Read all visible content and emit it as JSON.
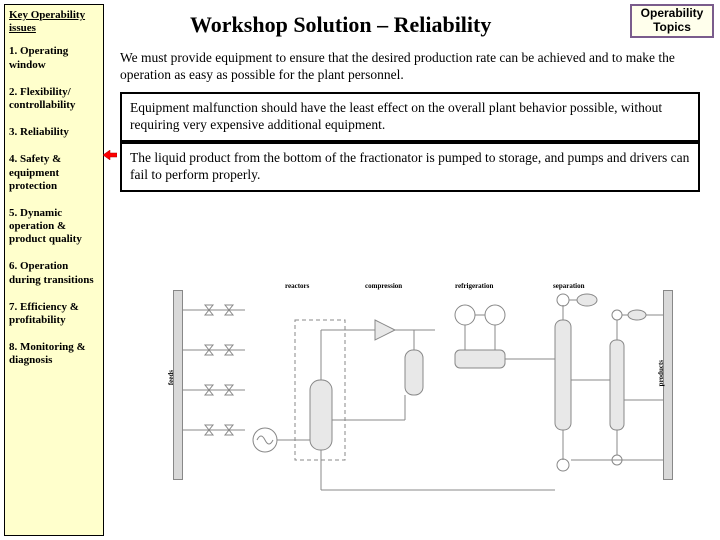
{
  "sidebar": {
    "title": "Key Operability issues",
    "items": [
      "1. Operating window",
      "2. Flexibility/ controllability",
      "3. Reliability",
      "4. Safety & equipment protection",
      "5. Dynamic operation & product quality",
      "6. Operation during transitions",
      "7. Efficiency & profitability",
      "8. Monitoring & diagnosis"
    ]
  },
  "topics_button": "Operability Topics",
  "title": "Workshop Solution – Reliability",
  "intro": "We must provide equipment to ensure that the desired production rate can be achieved and to make the operation as easy as possible for the plant personnel.",
  "box1": "Equipment malfunction should have the least effect on the overall plant behavior possible, without requiring very expensive additional equipment.",
  "box2": "The liquid product from the bottom of the fractionator is pumped to storage, and pumps and drivers can fail to perform properly.",
  "diagram": {
    "feeds": "feeds",
    "reactors": "reactors",
    "compression": "compression",
    "refrigeration": "refrigeration",
    "separation": "separation",
    "products": "products"
  }
}
